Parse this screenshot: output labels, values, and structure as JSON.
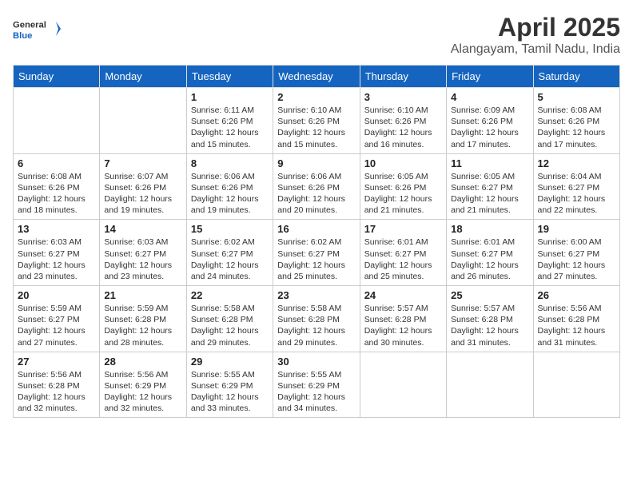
{
  "logo": {
    "general": "General",
    "blue": "Blue"
  },
  "title": "April 2025",
  "location": "Alangayam, Tamil Nadu, India",
  "weekdays": [
    "Sunday",
    "Monday",
    "Tuesday",
    "Wednesday",
    "Thursday",
    "Friday",
    "Saturday"
  ],
  "weeks": [
    [
      {
        "day": "",
        "info": ""
      },
      {
        "day": "",
        "info": ""
      },
      {
        "day": "1",
        "info": "Sunrise: 6:11 AM\nSunset: 6:26 PM\nDaylight: 12 hours and 15 minutes."
      },
      {
        "day": "2",
        "info": "Sunrise: 6:10 AM\nSunset: 6:26 PM\nDaylight: 12 hours and 15 minutes."
      },
      {
        "day": "3",
        "info": "Sunrise: 6:10 AM\nSunset: 6:26 PM\nDaylight: 12 hours and 16 minutes."
      },
      {
        "day": "4",
        "info": "Sunrise: 6:09 AM\nSunset: 6:26 PM\nDaylight: 12 hours and 17 minutes."
      },
      {
        "day": "5",
        "info": "Sunrise: 6:08 AM\nSunset: 6:26 PM\nDaylight: 12 hours and 17 minutes."
      }
    ],
    [
      {
        "day": "6",
        "info": "Sunrise: 6:08 AM\nSunset: 6:26 PM\nDaylight: 12 hours and 18 minutes."
      },
      {
        "day": "7",
        "info": "Sunrise: 6:07 AM\nSunset: 6:26 PM\nDaylight: 12 hours and 19 minutes."
      },
      {
        "day": "8",
        "info": "Sunrise: 6:06 AM\nSunset: 6:26 PM\nDaylight: 12 hours and 19 minutes."
      },
      {
        "day": "9",
        "info": "Sunrise: 6:06 AM\nSunset: 6:26 PM\nDaylight: 12 hours and 20 minutes."
      },
      {
        "day": "10",
        "info": "Sunrise: 6:05 AM\nSunset: 6:26 PM\nDaylight: 12 hours and 21 minutes."
      },
      {
        "day": "11",
        "info": "Sunrise: 6:05 AM\nSunset: 6:27 PM\nDaylight: 12 hours and 21 minutes."
      },
      {
        "day": "12",
        "info": "Sunrise: 6:04 AM\nSunset: 6:27 PM\nDaylight: 12 hours and 22 minutes."
      }
    ],
    [
      {
        "day": "13",
        "info": "Sunrise: 6:03 AM\nSunset: 6:27 PM\nDaylight: 12 hours and 23 minutes."
      },
      {
        "day": "14",
        "info": "Sunrise: 6:03 AM\nSunset: 6:27 PM\nDaylight: 12 hours and 23 minutes."
      },
      {
        "day": "15",
        "info": "Sunrise: 6:02 AM\nSunset: 6:27 PM\nDaylight: 12 hours and 24 minutes."
      },
      {
        "day": "16",
        "info": "Sunrise: 6:02 AM\nSunset: 6:27 PM\nDaylight: 12 hours and 25 minutes."
      },
      {
        "day": "17",
        "info": "Sunrise: 6:01 AM\nSunset: 6:27 PM\nDaylight: 12 hours and 25 minutes."
      },
      {
        "day": "18",
        "info": "Sunrise: 6:01 AM\nSunset: 6:27 PM\nDaylight: 12 hours and 26 minutes."
      },
      {
        "day": "19",
        "info": "Sunrise: 6:00 AM\nSunset: 6:27 PM\nDaylight: 12 hours and 27 minutes."
      }
    ],
    [
      {
        "day": "20",
        "info": "Sunrise: 5:59 AM\nSunset: 6:27 PM\nDaylight: 12 hours and 27 minutes."
      },
      {
        "day": "21",
        "info": "Sunrise: 5:59 AM\nSunset: 6:28 PM\nDaylight: 12 hours and 28 minutes."
      },
      {
        "day": "22",
        "info": "Sunrise: 5:58 AM\nSunset: 6:28 PM\nDaylight: 12 hours and 29 minutes."
      },
      {
        "day": "23",
        "info": "Sunrise: 5:58 AM\nSunset: 6:28 PM\nDaylight: 12 hours and 29 minutes."
      },
      {
        "day": "24",
        "info": "Sunrise: 5:57 AM\nSunset: 6:28 PM\nDaylight: 12 hours and 30 minutes."
      },
      {
        "day": "25",
        "info": "Sunrise: 5:57 AM\nSunset: 6:28 PM\nDaylight: 12 hours and 31 minutes."
      },
      {
        "day": "26",
        "info": "Sunrise: 5:56 AM\nSunset: 6:28 PM\nDaylight: 12 hours and 31 minutes."
      }
    ],
    [
      {
        "day": "27",
        "info": "Sunrise: 5:56 AM\nSunset: 6:28 PM\nDaylight: 12 hours and 32 minutes."
      },
      {
        "day": "28",
        "info": "Sunrise: 5:56 AM\nSunset: 6:29 PM\nDaylight: 12 hours and 32 minutes."
      },
      {
        "day": "29",
        "info": "Sunrise: 5:55 AM\nSunset: 6:29 PM\nDaylight: 12 hours and 33 minutes."
      },
      {
        "day": "30",
        "info": "Sunrise: 5:55 AM\nSunset: 6:29 PM\nDaylight: 12 hours and 34 minutes."
      },
      {
        "day": "",
        "info": ""
      },
      {
        "day": "",
        "info": ""
      },
      {
        "day": "",
        "info": ""
      }
    ]
  ]
}
